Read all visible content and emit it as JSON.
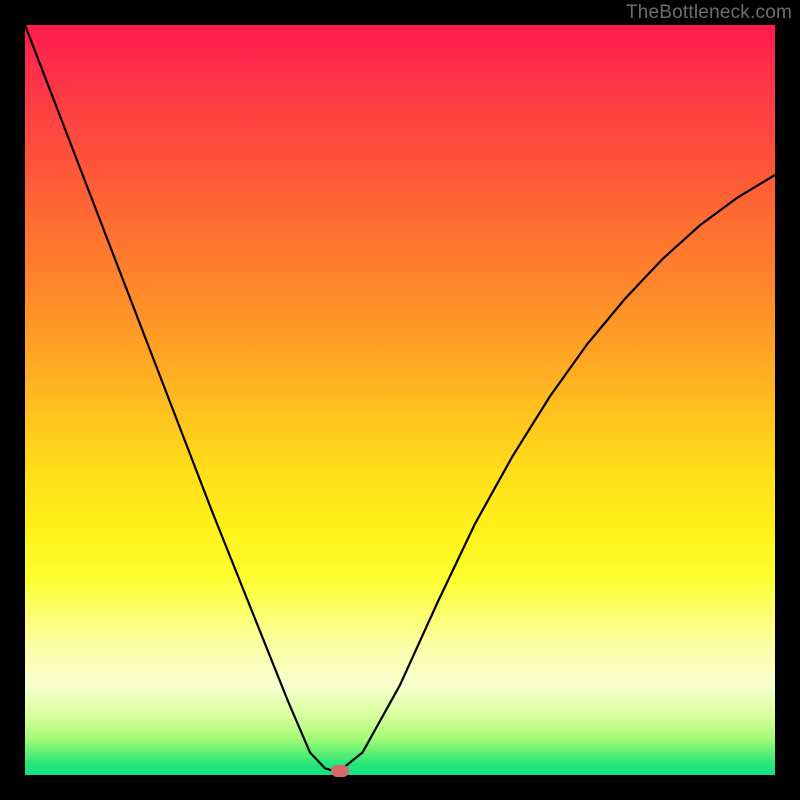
{
  "watermark": "TheBottleneck.com",
  "chart_data": {
    "type": "line",
    "title": "",
    "xlabel": "",
    "ylabel": "",
    "xlim": [
      0,
      100
    ],
    "ylim": [
      0,
      100
    ],
    "grid": false,
    "legend": false,
    "series": [
      {
        "name": "curve",
        "x": [
          0,
          5,
          10,
          15,
          20,
          25,
          30,
          35,
          38,
          40,
          41,
          42,
          45,
          50,
          55,
          60,
          65,
          70,
          75,
          80,
          85,
          90,
          95,
          100
        ],
        "values": [
          100,
          87,
          74,
          61,
          48,
          35,
          22.5,
          10,
          3,
          0.9,
          0.6,
          0.6,
          3,
          12,
          23,
          33.5,
          42.5,
          50.5,
          57.5,
          63.5,
          68.8,
          73.3,
          77,
          80
        ]
      }
    ],
    "marker": {
      "x": 42,
      "y": 0.6
    },
    "background_gradient": {
      "top": "#ff1a4d",
      "mid": "#ffe01a",
      "bottom": "#10df84"
    },
    "curve_color": "#000000",
    "marker_color": "#d46a6a"
  }
}
